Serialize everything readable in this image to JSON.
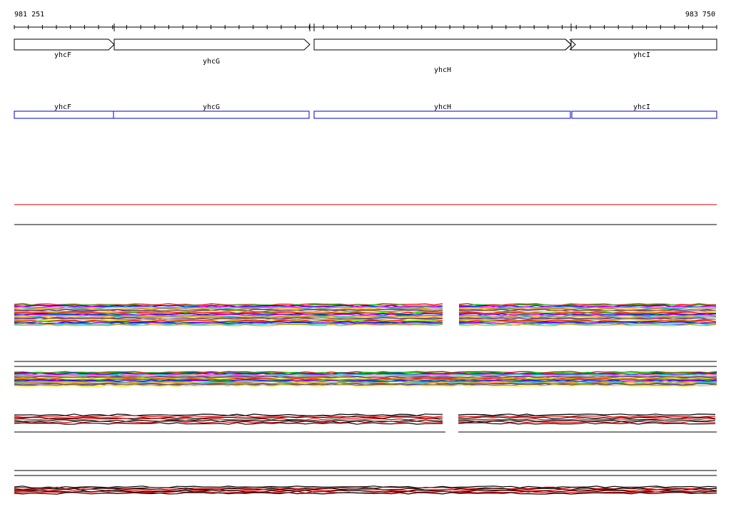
{
  "region": {
    "start": "981 251",
    "end": "983 750"
  },
  "genes": [
    {
      "name": "yhcF",
      "kind": "arrow"
    },
    {
      "name": "yhcG",
      "kind": "arrow"
    },
    {
      "name": "yhcH",
      "kind": "arrow"
    },
    {
      "name": "yhcI",
      "kind": "arrow"
    }
  ],
  "annotation_track": [
    {
      "name": "yhcF"
    },
    {
      "name": "yhcG"
    },
    {
      "name": "yhcH"
    },
    {
      "name": "yhcI"
    }
  ],
  "colors": {
    "axis": "#000000",
    "gene_outline": "#000000",
    "annotation_box": "#0000cc",
    "reference_line": "#cc0000",
    "profile_primary": "#000000",
    "profile_secondary": "#dd0000",
    "profile_palette": [
      "#ff0000",
      "#00cc00",
      "#0000ff",
      "#ff00ff",
      "#00cccc",
      "#ffaa00",
      "#888888",
      "#663399",
      "#996633",
      "#ccff00"
    ]
  }
}
